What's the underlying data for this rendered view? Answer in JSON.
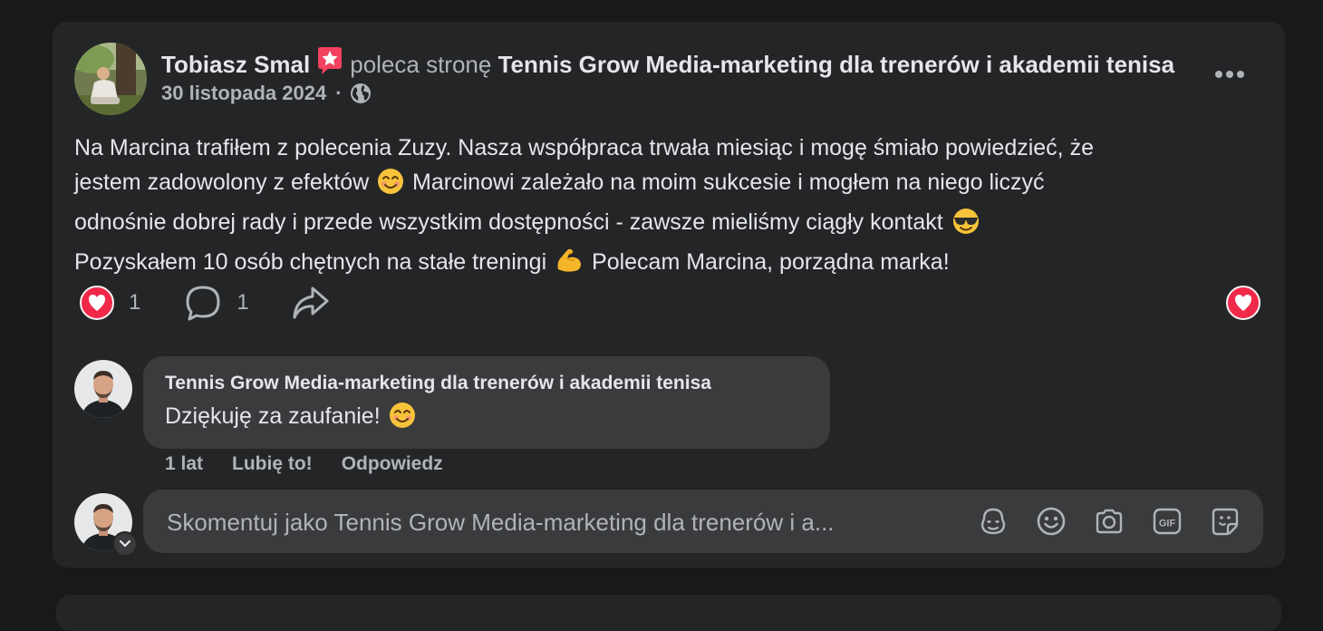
{
  "post": {
    "author": "Tobiasz Smal",
    "recommends_text": "poleca stronę",
    "page_name": "Tennis Grow Media-marketing dla trenerów i akademii tenisa",
    "date": "30 listopada 2024",
    "separator": "·",
    "privacy_icon": "globe-icon",
    "text_lines": [
      [
        "Na Marcina trafiłem z polecenia Zuzy. Nasza współpraca trwała miesiąc i mogę śmiało powiedzieć, że"
      ],
      [
        "jestem zadowolony z efektów ",
        " Marcinowi zależało na moim sukcesie i mogłem na niego liczyć"
      ],
      [
        "odnośnie dobrej rady i przede wszystkim dostępności - zawsze mieliśmy ciągły kontakt "
      ],
      [
        "Pozyskałem 10 osób chętnych na stałe treningi ",
        " Polecam Marcina, porządna marka!"
      ]
    ],
    "emojis": [
      "smiling-face-emoji",
      "sunglasses-face-emoji",
      "flexed-biceps-emoji"
    ],
    "reaction_count": "1",
    "comment_count": "1"
  },
  "comment": {
    "author": "Tennis Grow Media-marketing dla trenerów i akademii tenisa",
    "text": "Dziękuję za zaufanie!",
    "time": "1 lat",
    "like_label": "Lubię to!",
    "reply_label": "Odpowiedz"
  },
  "composer": {
    "placeholder": "Skomentuj jako Tennis Grow Media-marketing dla trenerów i a..."
  },
  "colors": {
    "background": "#18191a",
    "card": "#242526",
    "bubble": "#3a3b3c",
    "primary_text": "#e4e6eb",
    "secondary_text": "#b0b3b8",
    "love_red": "#f02849",
    "badge_pink": "#f3425f"
  }
}
